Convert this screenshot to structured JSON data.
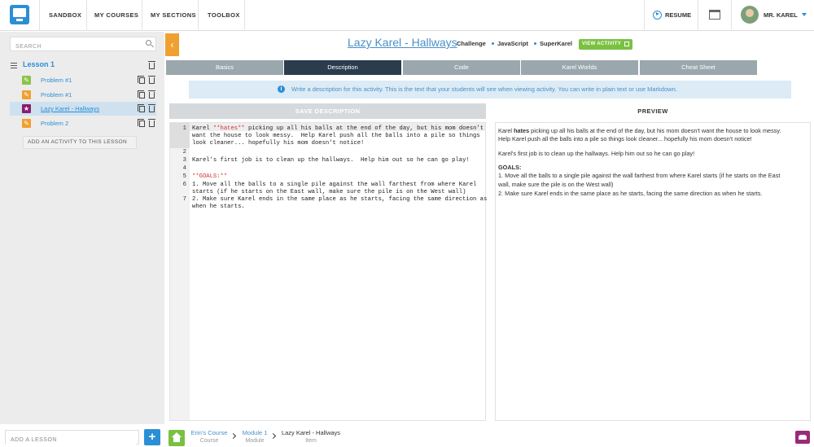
{
  "nav": {
    "items": [
      "SANDBOX",
      "MY COURSES",
      "MY SECTIONS",
      "TOOLBOX"
    ],
    "resume": "RESUME",
    "user": "MR. KAREL"
  },
  "sidebar": {
    "search_placeholder": "SEARCH",
    "lesson_title": "Lesson 1",
    "activities": [
      {
        "label": "Problem #1",
        "icon": "check-edit-icon",
        "color": "#8bc34a"
      },
      {
        "label": "Problem #1",
        "icon": "pencil-icon",
        "color": "#f0a030"
      },
      {
        "label": "Lazy Karel - Hallways",
        "icon": "star-icon",
        "color": "#8b1d6b"
      },
      {
        "label": "Problem 2",
        "icon": "pencil-icon",
        "color": "#f0a030"
      }
    ],
    "add_activity": "ADD AN ACTIVITY TO THIS LESSON",
    "add_lesson_placeholder": "ADD A LESSON"
  },
  "header": {
    "title": "Lazy Karel - Hallways",
    "meta": [
      "Challenge",
      "JavaScript",
      "SuperKarel"
    ],
    "view_activity": "VIEW ACTIVITY"
  },
  "tabs": [
    "Basics",
    "Description",
    "Code",
    "Karel Worlds",
    "Cheat Sheet"
  ],
  "active_tab": "Description",
  "info": "Write a description for this activity. This is the text that your students will see when viewing activity. You can write in plain text or use Markdown.",
  "editor": {
    "save_label": "SAVE DESCRIPTION",
    "line_numbers": [
      "1",
      "2",
      "3",
      "4",
      "5",
      "6",
      "7"
    ],
    "lines": {
      "l1a_pre": "Karel ",
      "l1a_hl": "**hates**",
      "l1a_post": " picking up all his balls at the end of the day, but his mom doesn't",
      "l1b": "want the house to look messy.  Help Karel push all the balls into a pile so things",
      "l1c": "look cleaner... hopefully his mom doesn't notice!",
      "l3": "Karel's first job is to clean up the hallways.  Help him out so he can go play!",
      "l5": "**GOALS:**",
      "l6a": "1. Move all the balls to a single pile against the wall farthest from where Karel",
      "l6b": "starts (if he starts on the East wall, make sure the pile is on the West wall)",
      "l7a": "2. Make sure Karel ends in the same place as he starts, facing the same direction as",
      "l7b": "when he starts."
    }
  },
  "preview": {
    "heading": "PREVIEW",
    "p1_a": "Karel ",
    "p1_b": "hates",
    "p1_c": " picking up all his balls at the end of the day, but his mom doesn't want the house to look messy.",
    "p1_d": "Help Karel push all the balls into a pile so things look cleaner... hopefully his mom doesn't notice!",
    "p2": "Karel's first job is to clean up the hallways. Help him out so he can go play!",
    "goals": "GOALS:",
    "g1a": "1. Move all the balls to a single pile against the wall farthest from where Karel starts (if he starts on the East",
    "g1b": "wall, make sure the pile is on the West wall)",
    "g2": "2. Make sure Karel ends in the same place as he starts, facing the same direction as when he starts."
  },
  "breadcrumb": [
    {
      "label": "Erin's Course",
      "type": "Course"
    },
    {
      "label": "Module 1",
      "type": "Module"
    },
    {
      "label": "Lazy Karel - Hallways",
      "type": "Item"
    }
  ]
}
